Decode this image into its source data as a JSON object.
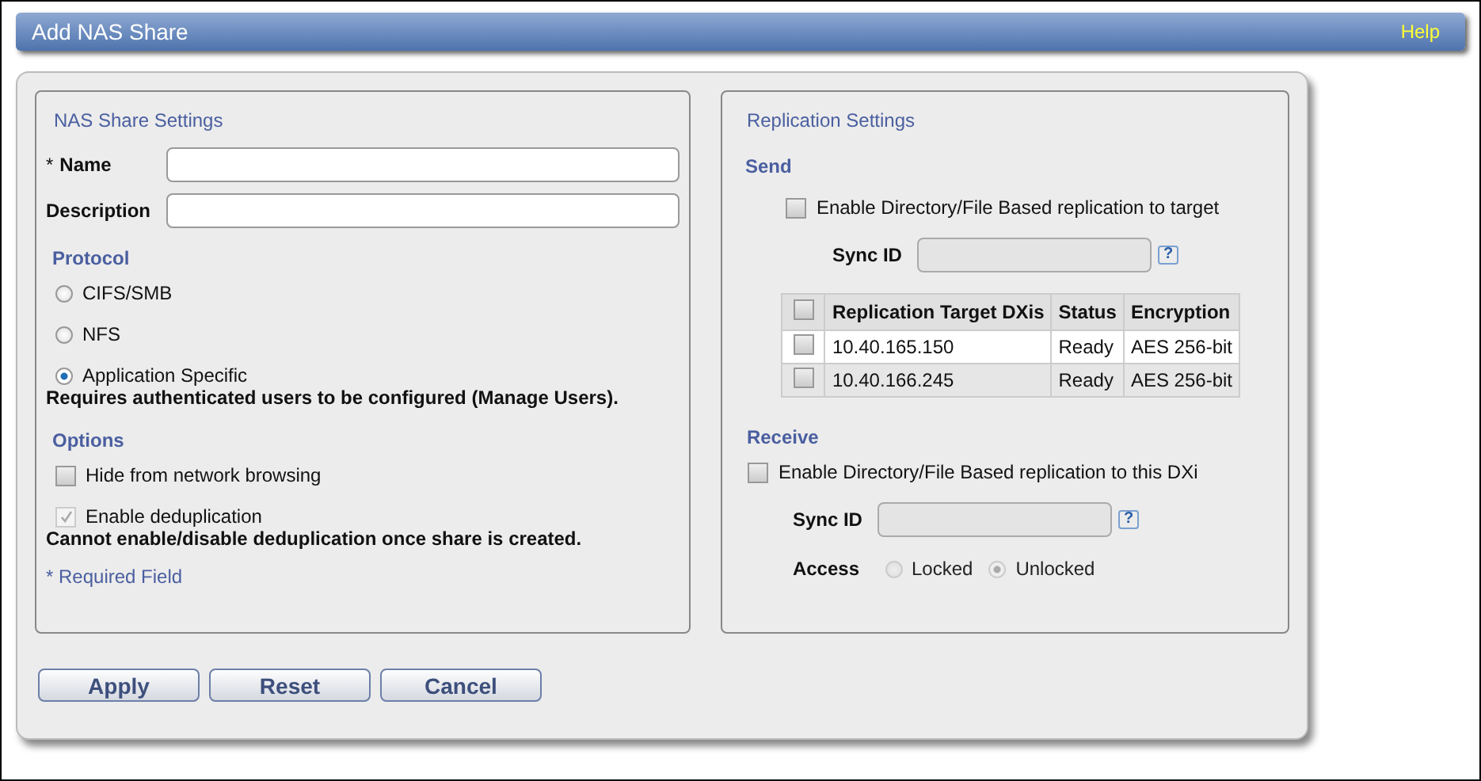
{
  "window": {
    "title": "Add NAS Share",
    "help": "Help"
  },
  "nas_settings": {
    "title": "NAS Share Settings",
    "fields": [
      {
        "label": "Name",
        "required_mark": "*"
      },
      {
        "label": "Description"
      }
    ],
    "protocol": {
      "heading": "Protocol",
      "options": [
        {
          "label": "CIFS/SMB",
          "selected": false
        },
        {
          "label": "NFS",
          "selected": false
        },
        {
          "label": "Application Specific",
          "selected": true
        }
      ],
      "note": "Requires authenticated users to be configured (Manage Users)."
    },
    "options": {
      "heading": "Options",
      "items": [
        {
          "label": "Hide from network browsing",
          "checked": false,
          "disabled": false
        },
        {
          "label": "Enable deduplication",
          "checked": true,
          "disabled": true
        }
      ],
      "note": "Cannot enable/disable deduplication once share is created."
    },
    "required_note": "* Required Field"
  },
  "replication": {
    "title": "Replication Settings",
    "send": {
      "heading": "Send",
      "enable": {
        "label": "Enable Directory/File Based replication to target",
        "checked": false
      },
      "sync_id": {
        "label": "Sync ID",
        "disabled": true,
        "help": "?"
      },
      "table": {
        "columns": [
          "Replication Target DXis",
          "Status",
          "Encryption"
        ],
        "all_checked": false,
        "rows": [
          {
            "cells": [
              "10.40.165.150",
              "Ready",
              "AES 256-bit"
            ],
            "checked": false
          },
          {
            "cells": [
              "10.40.166.245",
              "Ready",
              "AES 256-bit"
            ],
            "checked": false
          }
        ]
      }
    },
    "receive": {
      "heading": "Receive",
      "enable": {
        "label": "Enable Directory/File Based replication to this DXi",
        "checked": false
      },
      "sync_id": {
        "label": "Sync ID",
        "disabled": true,
        "help": "?"
      },
      "access": {
        "label": "Access",
        "disabled": true,
        "options": [
          {
            "label": "Locked",
            "selected": false
          },
          {
            "label": "Unlocked",
            "selected": true
          }
        ]
      }
    }
  },
  "buttons": [
    "Apply",
    "Reset",
    "Cancel"
  ]
}
